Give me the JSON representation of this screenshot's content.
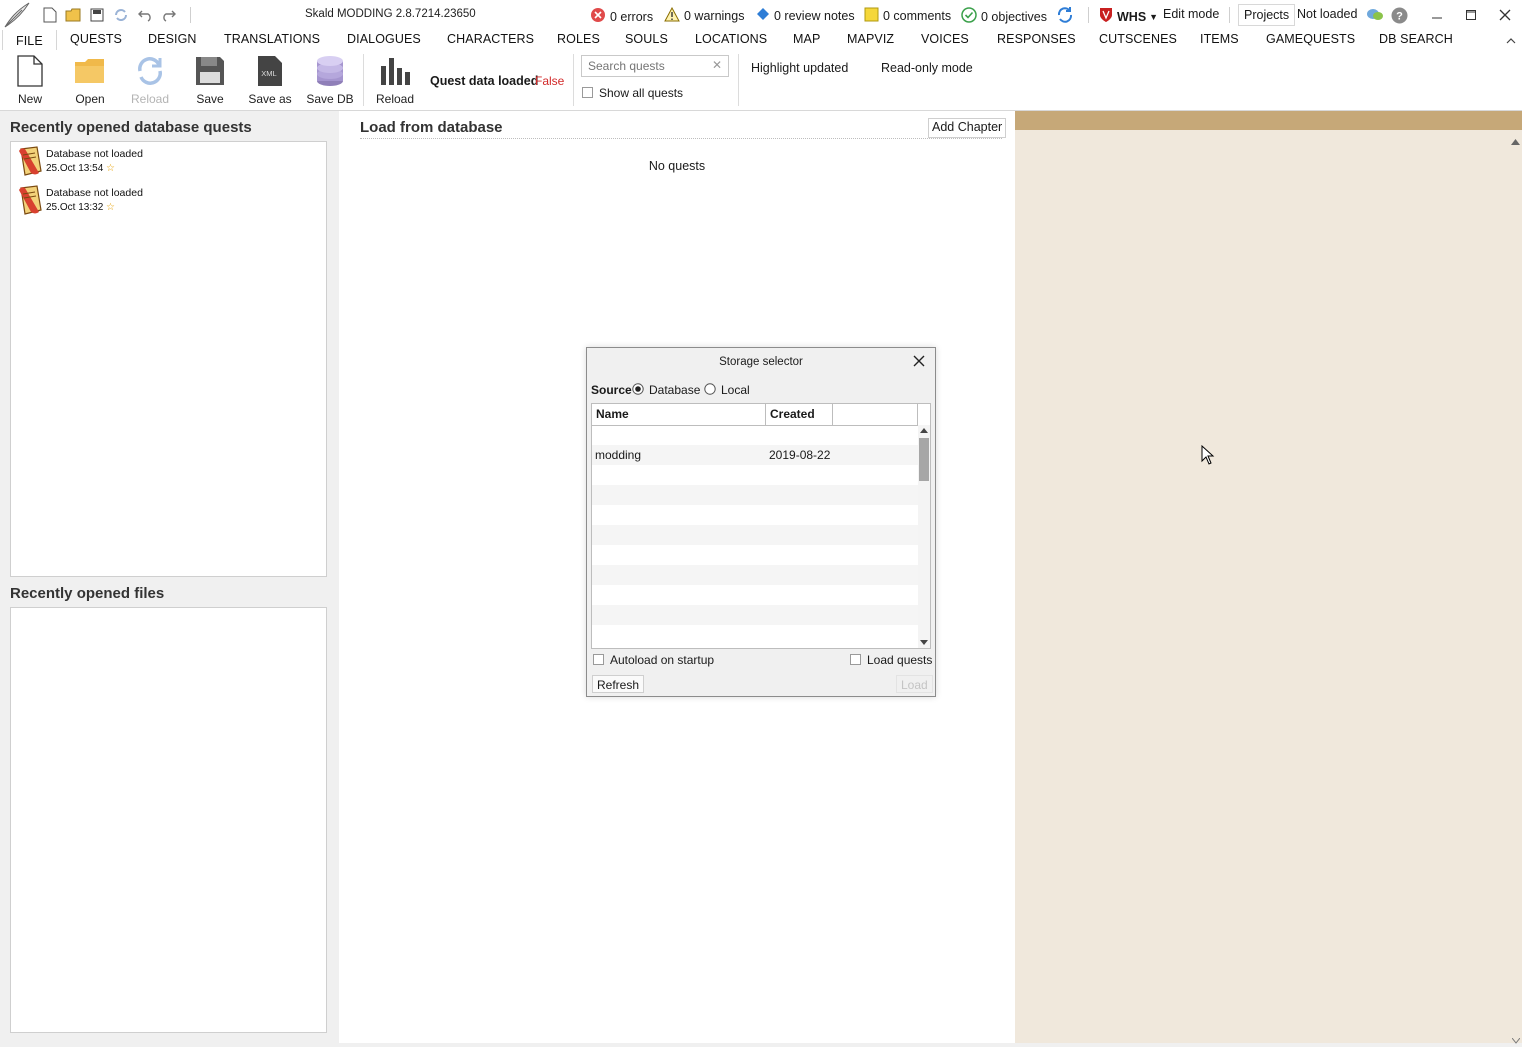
{
  "window": {
    "title": "Skald MODDING 2.8.7214.23650",
    "status": {
      "errors": "0 errors",
      "warnings": "0 warnings",
      "review_notes": "0 review notes",
      "comments": "0 comments",
      "objectives": "0 objectives"
    },
    "project_code": "WHS",
    "mode": "Edit mode",
    "projects_label": "Projects",
    "load_status": "Not loaded"
  },
  "menu": {
    "tabs": [
      "FILE",
      "QUESTS",
      "DESIGN",
      "TRANSLATIONS",
      "DIALOGUES",
      "CHARACTERS",
      "ROLES",
      "SOULS",
      "LOCATIONS",
      "MAP",
      "MAPVIZ",
      "VOICES",
      "RESPONSES",
      "CUTSCENES",
      "ITEMS",
      "GAMEQUESTS",
      "DB SEARCH"
    ],
    "active": "FILE"
  },
  "ribbon": {
    "buttons": {
      "new": "New",
      "open": "Open",
      "reload": "Reload",
      "save": "Save",
      "save_as": "Save as",
      "save_db": "Save DB",
      "reload2": "Reload"
    },
    "quest_data_label": "Quest data loaded",
    "quest_data_value": "False",
    "search_placeholder": "Search quests",
    "show_all_quests": "Show all quests",
    "highlight_updated": "Highlight updated",
    "readonly_mode": "Read-only mode"
  },
  "left": {
    "recent_db_title": "Recently opened database quests",
    "recent_db_items": [
      {
        "name": "Database not loaded",
        "date": "25.Oct 13:54"
      },
      {
        "name": "Database not loaded",
        "date": "25.Oct 13:32"
      }
    ],
    "recent_files_title": "Recently opened files"
  },
  "center": {
    "title": "Load from database",
    "add_chapter": "Add Chapter",
    "empty_text": "No quests"
  },
  "dialog": {
    "title": "Storage selector",
    "source_label": "Source",
    "source_options": [
      "Database",
      "Local"
    ],
    "source_selected": "Database",
    "columns": [
      "Name",
      "Created"
    ],
    "rows": [
      {
        "name": "modding",
        "created": "2019-08-22"
      }
    ],
    "autoload": "Autoload on startup",
    "load_quests": "Load quests",
    "refresh": "Refresh",
    "load": "Load"
  },
  "colors": {
    "error_red": "#e04a4a",
    "false_red": "#d22a2a",
    "right_panel_bg": "#f0e8dc",
    "right_panel_bar": "#c6a878"
  }
}
